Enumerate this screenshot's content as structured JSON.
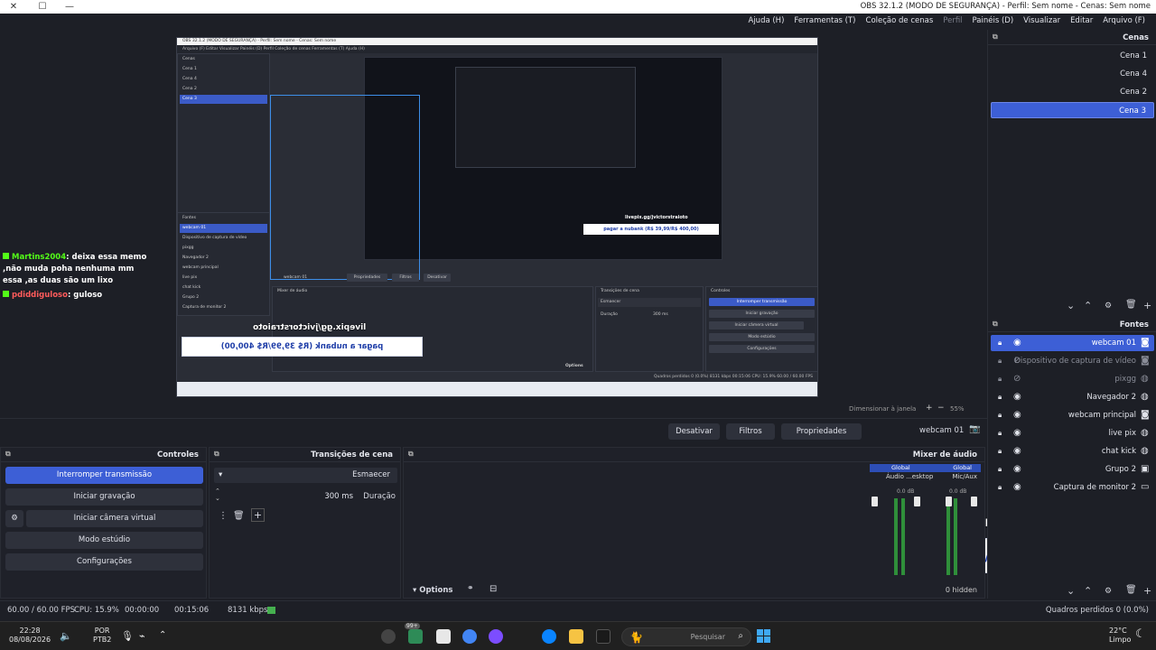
{
  "window": {
    "title": "OBS 32.1.2 (MODO DE SEGURANÇA) - Perfil: Sem nome - Cenas: Sem nome",
    "minimize": "—",
    "maximize": "☐"
  },
  "menu": [
    "Arquivo (F)",
    "Editar",
    "Visualizar",
    "Painéis (D)",
    "Perfil",
    "Coleção de cenas",
    "Ferramentas (T)",
    "Ajuda (H)"
  ],
  "menu_dim_index": 4,
  "preview": {
    "chat": [
      {
        "nick": "Martins2004",
        "text": ": deixa essa memo ,não muda poha nenhuma mm essa ,as duas são um lixo"
      },
      {
        "nick": "pdiddiguloso",
        "text": ": guloso"
      }
    ],
    "overlay_url": "livepix.gg/jvictorstraioto",
    "overlay_bar": "pagar a nubank (R$ 39,99/R$ 400,00)",
    "nested": {
      "title": "OBS 32.1.2 (MODO DE SEGURANÇA) - Perfil: Sem nome - Cenas: Sem nome",
      "menu": "Arquivo (F)   Editar   Visualizar   Painéis (D)   Perfil   Coleção de cenas   Ferramentas (T)   Ajuda (H)",
      "scenes_title": "Cenas",
      "scenes": [
        "Cena 1",
        "Cena 4",
        "Cena 2",
        "Cena 3"
      ],
      "sources_title": "Fontes",
      "sources": [
        "webcam 01",
        "Dispositivo de captura de vídeo",
        "pixgg",
        "Navegador 2",
        "webcam principal",
        "live pix",
        "chat kick",
        "Grupo 2",
        "Captura de monitor 2"
      ],
      "source_bar": [
        "webcam 01",
        "Propriedades",
        "Filtros",
        "Desativar"
      ],
      "mixer_title": "Mixer de áudio",
      "transitions_title": "Transições de cena",
      "transition": "Esmaecer",
      "duration_label": "Duração",
      "duration": "300 ms",
      "controls_title": "Controles",
      "controls": [
        "Interromper transmissão",
        "Iniciar gravação",
        "Iniciar câmera virtual",
        "Modo estúdio",
        "Configurações"
      ],
      "options": "Options",
      "status": "Quadros perdidos 0 (0.0%)   8131 kbps   00:15:06   CPU: 15.9%   60.00 / 60.00 FPS"
    }
  },
  "preview_status": {
    "dimension_label": "Dimensionar à janela",
    "zoom": "55%"
  },
  "scenes_dock": {
    "title": "Cenas",
    "items": [
      "Cena 1",
      "Cena 4",
      "Cena 2",
      "Cena 3"
    ],
    "active_index": 3
  },
  "sources_dock": {
    "title": "Fontes",
    "items": [
      {
        "name": "webcam 01",
        "icon": "camera-icon",
        "visible": true,
        "active": true
      },
      {
        "name": "Dispositivo de captura de vídeo",
        "icon": "camera-icon",
        "visible": false
      },
      {
        "name": "pixgg",
        "icon": "globe-icon",
        "visible": false
      },
      {
        "name": "Navegador 2",
        "icon": "globe-icon",
        "visible": true
      },
      {
        "name": "webcam principal",
        "icon": "camera-icon",
        "visible": true
      },
      {
        "name": "live pix",
        "icon": "globe-icon",
        "visible": true
      },
      {
        "name": "chat kick",
        "icon": "globe-icon",
        "visible": true
      },
      {
        "name": "Grupo 2",
        "icon": "folder-icon",
        "visible": true
      },
      {
        "name": "Captura de monitor 2",
        "icon": "monitor-icon",
        "visible": true
      }
    ]
  },
  "source_toolbar": {
    "source_name": "webcam 01",
    "properties": "Propriedades",
    "filters": "Filtros",
    "deactivate": "Desativar"
  },
  "mixer": {
    "title": "Mixer de áudio",
    "channels": [
      {
        "name": "Mic/Aux",
        "badge": "Global",
        "level": "0.0 dB"
      },
      {
        "name": "Áudio ...esktop",
        "badge": "Global",
        "level": "0.0 dB"
      }
    ],
    "hidden_label": "0 hidden",
    "options": "Options"
  },
  "transitions": {
    "title": "Transições de cena",
    "transition": "Esmaecer",
    "duration_label": "Duração",
    "duration": "300 ms"
  },
  "controls": {
    "title": "Controles",
    "buttons": [
      "Interromper transmissão",
      "Iniciar gravação",
      "Iniciar câmera virtual",
      "Modo estúdio",
      "Configurações"
    ]
  },
  "status": {
    "dropped": "Quadros perdidos 0 (0.0%)",
    "bitrate": "8131 kbps",
    "stream_time": "00:15:06",
    "rec_time": "00:00:00",
    "cpu": "CPU: 15.9%",
    "fps": "60.00 / 60.00 FPS"
  },
  "taskbar": {
    "weather_temp": "22°C",
    "weather_text": "Limpo",
    "search_placeholder": "Pesquisar",
    "badge": "99+",
    "lang1": "POR",
    "lang2": "PTB2",
    "time": "22:28",
    "date": "08/08/2026"
  },
  "colors": {
    "accent": "#3d5fd6",
    "kick_green": "#53fc18",
    "overlay_text": "#1f3ea8"
  }
}
